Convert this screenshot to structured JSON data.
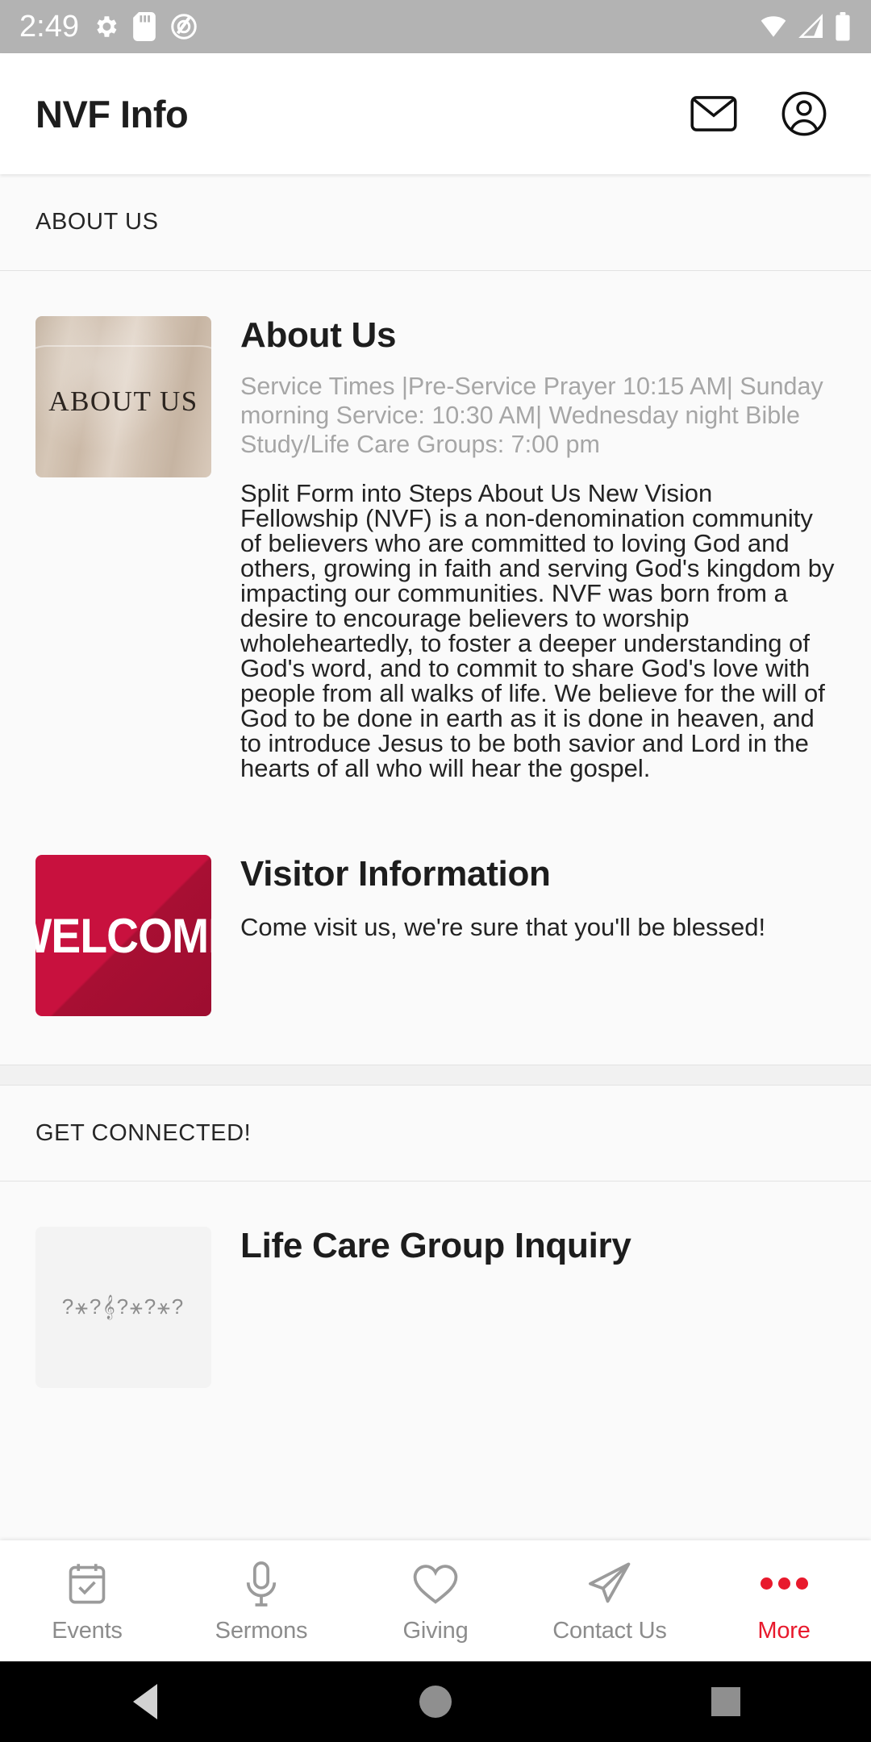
{
  "status_bar": {
    "time": "2:49",
    "left_icons": [
      "gear-icon",
      "sd-card-icon",
      "screen-record-icon"
    ],
    "right_icons": [
      "wifi-icon",
      "cellular-signal-icon",
      "battery-icon"
    ],
    "background_color": "#b3b3b3"
  },
  "app_bar": {
    "title": "NVF Info",
    "actions": [
      {
        "name": "mail-icon",
        "label": "Mail"
      },
      {
        "name": "account-icon",
        "label": "Account"
      }
    ]
  },
  "sections": [
    {
      "header": "ABOUT US",
      "items": [
        {
          "thumb_text": "ABOUT US",
          "title": "About Us",
          "subtitle": "Service Times |Pre-Service Prayer 10:15 AM| Sunday morning Service: 10:30 AM| Wednesday night Bible Study/Life Care Groups: 7:00 pm",
          "body": "Split Form into Steps About Us New Vision Fellowship (NVF) is a non-denomination community of believers who are committed to loving God and others, growing in faith and serving God's kingdom by impacting our communities. NVF was born from a desire to encourage believers to worship wholeheartedly, to foster a deeper understanding of God's word, and to commit to share God's love with people from all walks of life. We believe for the will of God to be done in earth as it is done in heaven, and to introduce Jesus to be both savior and Lord in the hearts of all who will hear the gospel."
        },
        {
          "thumb_text": "WELCOME",
          "title": "Visitor Information",
          "description": "Come visit us, we're sure that you'll be blessed!"
        }
      ]
    },
    {
      "header": "GET CONNECTED!",
      "items": [
        {
          "thumb_text": "",
          "title": "Life Care Group Inquiry"
        }
      ]
    }
  ],
  "tab_bar": {
    "accent_color": "#e8192c",
    "inactive_color": "#8c8c8c",
    "tabs": [
      {
        "label": "Events",
        "icon": "calendar-check-icon",
        "active": false
      },
      {
        "label": "Sermons",
        "icon": "microphone-icon",
        "active": false
      },
      {
        "label": "Giving",
        "icon": "heart-icon",
        "active": false
      },
      {
        "label": "Contact Us",
        "icon": "paper-plane-icon",
        "active": false
      },
      {
        "label": "More",
        "icon": "more-dots-icon",
        "active": true
      }
    ]
  },
  "nav_bar": {
    "buttons": [
      "back-triangle-icon",
      "home-circle-icon",
      "recents-square-icon"
    ]
  }
}
